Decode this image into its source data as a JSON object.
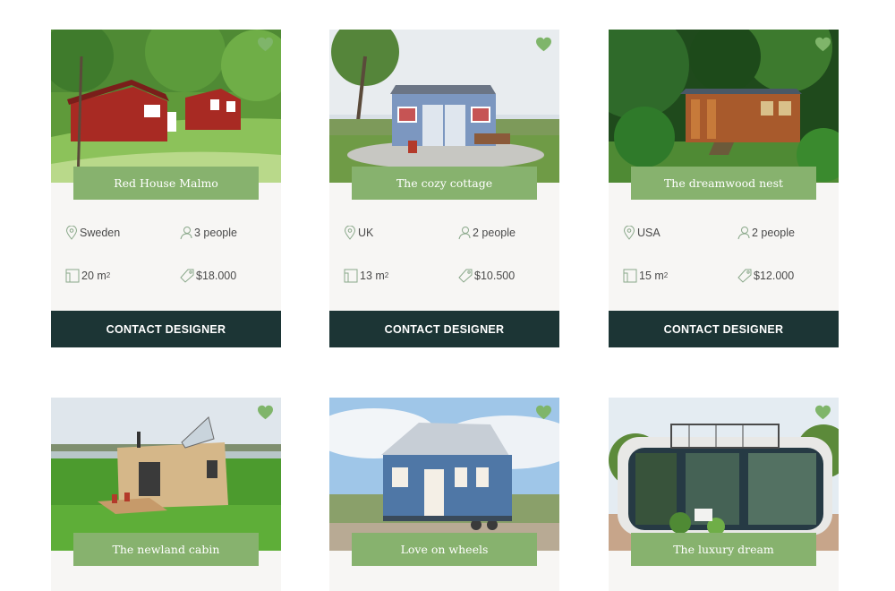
{
  "cards": [
    {
      "title": "Red House Malmo",
      "location": "Sweden",
      "people": "3 people",
      "area": "20 m",
      "area_sup": "2",
      "price": "$18.000",
      "cta": "CONTACT DESIGNER"
    },
    {
      "title": "The cozy cottage",
      "location": "UK",
      "people": "2 people",
      "area": "13 m",
      "area_sup": "2",
      "price": "$10.500",
      "cta": "CONTACT DESIGNER"
    },
    {
      "title": "The dreamwood nest",
      "location": "USA",
      "people": "2 people",
      "area": "15 m",
      "area_sup": "2",
      "price": "$12.000",
      "cta": "CONTACT DESIGNER"
    },
    {
      "title": "The newland cabin"
    },
    {
      "title": "Love on wheels"
    },
    {
      "title": "The luxury dream"
    }
  ],
  "colors": {
    "accent": "#87b26e",
    "dark": "#1c3535",
    "card_bg": "#f7f6f4"
  },
  "icons": [
    "heart-icon",
    "location-pin-icon",
    "person-icon",
    "area-icon",
    "price-tag-icon"
  ]
}
